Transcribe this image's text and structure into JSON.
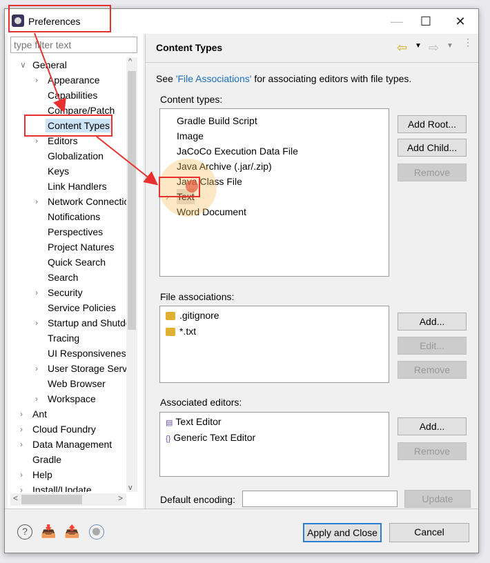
{
  "window": {
    "title": "Preferences",
    "minimize": "—",
    "maximize": "☐",
    "close": "✕"
  },
  "filter": {
    "placeholder": "type filter text"
  },
  "tree": [
    {
      "label": "General",
      "level": 0,
      "state": "open"
    },
    {
      "label": "Appearance",
      "level": 1,
      "state": "closed"
    },
    {
      "label": "Capabilities",
      "level": 1,
      "state": "leaf"
    },
    {
      "label": "Compare/Patch",
      "level": 1,
      "state": "leaf"
    },
    {
      "label": "Content Types",
      "level": 1,
      "state": "leaf",
      "selected": true
    },
    {
      "label": "Editors",
      "level": 1,
      "state": "closed"
    },
    {
      "label": "Globalization",
      "level": 1,
      "state": "leaf"
    },
    {
      "label": "Keys",
      "level": 1,
      "state": "leaf"
    },
    {
      "label": "Link Handlers",
      "level": 1,
      "state": "leaf"
    },
    {
      "label": "Network Connections",
      "level": 1,
      "state": "closed"
    },
    {
      "label": "Notifications",
      "level": 1,
      "state": "leaf"
    },
    {
      "label": "Perspectives",
      "level": 1,
      "state": "leaf"
    },
    {
      "label": "Project Natures",
      "level": 1,
      "state": "leaf"
    },
    {
      "label": "Quick Search",
      "level": 1,
      "state": "leaf"
    },
    {
      "label": "Search",
      "level": 1,
      "state": "leaf"
    },
    {
      "label": "Security",
      "level": 1,
      "state": "closed"
    },
    {
      "label": "Service Policies",
      "level": 1,
      "state": "leaf"
    },
    {
      "label": "Startup and Shutdown",
      "level": 1,
      "state": "closed"
    },
    {
      "label": "Tracing",
      "level": 1,
      "state": "leaf"
    },
    {
      "label": "UI Responsiveness",
      "level": 1,
      "state": "leaf"
    },
    {
      "label": "User Storage Service",
      "level": 1,
      "state": "closed"
    },
    {
      "label": "Web Browser",
      "level": 1,
      "state": "leaf"
    },
    {
      "label": "Workspace",
      "level": 1,
      "state": "closed"
    },
    {
      "label": "Ant",
      "level": 0,
      "state": "closed"
    },
    {
      "label": "Cloud Foundry",
      "level": 0,
      "state": "closed"
    },
    {
      "label": "Data Management",
      "level": 0,
      "state": "closed"
    },
    {
      "label": "Gradle",
      "level": 0,
      "state": "leaf"
    },
    {
      "label": "Help",
      "level": 0,
      "state": "closed"
    },
    {
      "label": "Install/Update",
      "level": 0,
      "state": "closed"
    }
  ],
  "page": {
    "title": "Content Types",
    "desc_prefix": "See ",
    "desc_link": "'File Associations'",
    "desc_suffix": " for associating editors with file types.",
    "content_types_label": "Content types:",
    "content_types": [
      "Gradle Build Script",
      "Image",
      "JaCoCo Execution Data File",
      "Java Archive (.jar/.zip)",
      "Java Class File",
      "Text",
      "Word Document"
    ],
    "add_root": "Add Root...",
    "add_child": "Add Child...",
    "remove": "Remove",
    "file_assoc_label": "File associations:",
    "file_assoc": [
      ".gitignore",
      "*.txt"
    ],
    "add": "Add...",
    "edit": "Edit...",
    "editors_label": "Associated editors:",
    "editors": [
      "Text Editor",
      "Generic Text Editor"
    ],
    "encoding_label": "Default encoding:",
    "encoding_value": "",
    "update": "Update"
  },
  "footer": {
    "apply_close": "Apply and Close",
    "cancel": "Cancel"
  },
  "annotation_color": "#e8312f"
}
